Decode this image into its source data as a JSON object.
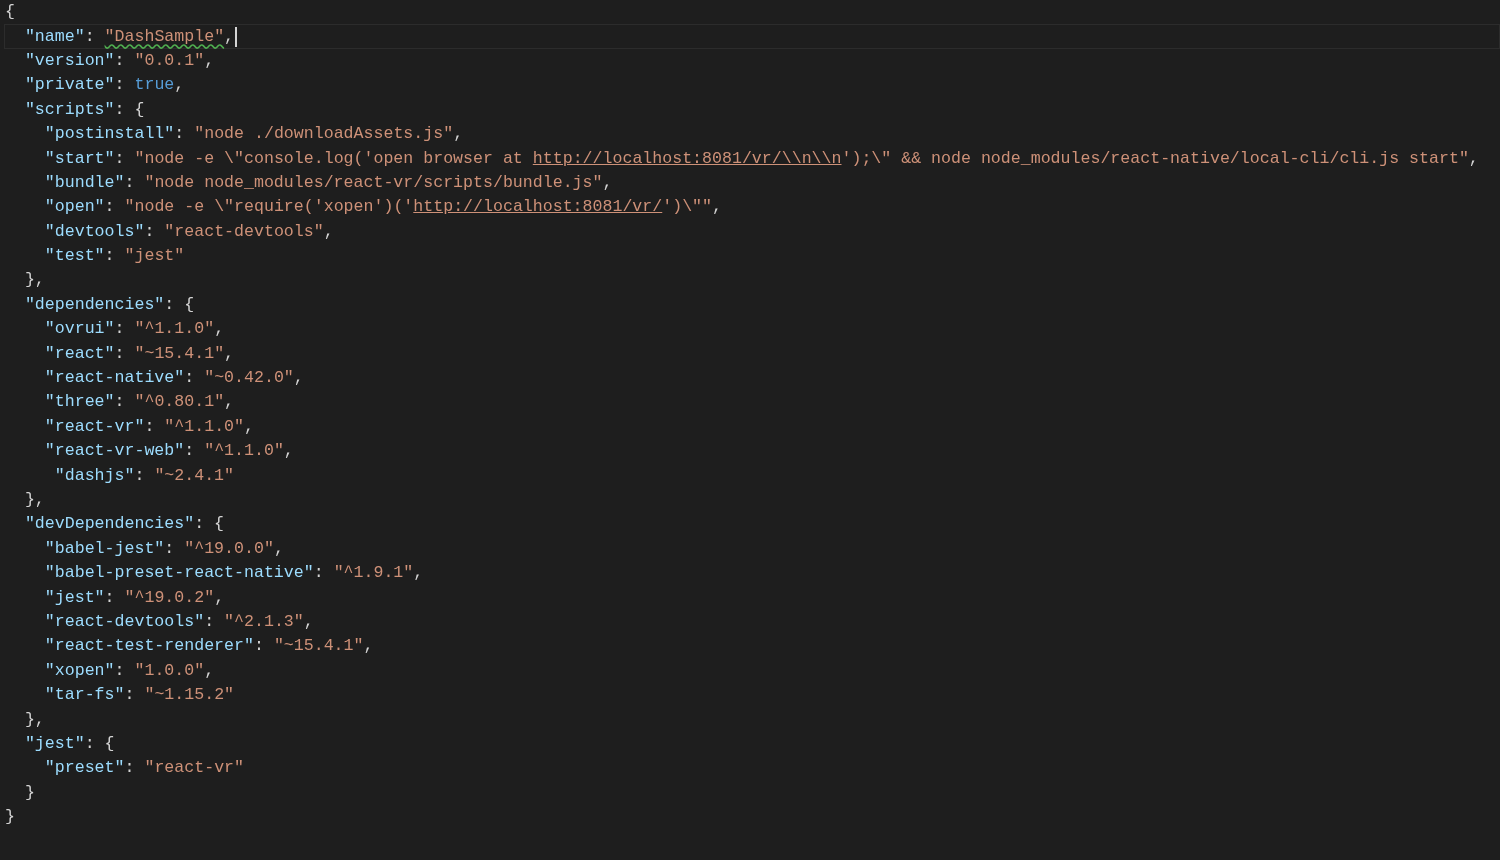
{
  "editor": {
    "lines": [
      {
        "current": false,
        "cursor": false,
        "tokens": [
          {
            "kind": "punct",
            "text": "{"
          }
        ]
      },
      {
        "current": true,
        "cursor": true,
        "tokens": [
          {
            "kind": "key",
            "text": "  \"name\""
          },
          {
            "kind": "punct",
            "text": ": "
          },
          {
            "kind": "string",
            "text": "\"DashSample\"",
            "squiggle": true
          },
          {
            "kind": "punct",
            "text": ","
          }
        ]
      },
      {
        "current": false,
        "cursor": false,
        "tokens": [
          {
            "kind": "key",
            "text": "  \"version\""
          },
          {
            "kind": "punct",
            "text": ": "
          },
          {
            "kind": "string",
            "text": "\"0.0.1\""
          },
          {
            "kind": "punct",
            "text": ","
          }
        ]
      },
      {
        "current": false,
        "cursor": false,
        "tokens": [
          {
            "kind": "key",
            "text": "  \"private\""
          },
          {
            "kind": "punct",
            "text": ": "
          },
          {
            "kind": "bool",
            "text": "true"
          },
          {
            "kind": "punct",
            "text": ","
          }
        ]
      },
      {
        "current": false,
        "cursor": false,
        "tokens": [
          {
            "kind": "key",
            "text": "  \"scripts\""
          },
          {
            "kind": "punct",
            "text": ": {"
          }
        ]
      },
      {
        "current": false,
        "cursor": false,
        "tokens": [
          {
            "kind": "key",
            "text": "    \"postinstall\""
          },
          {
            "kind": "punct",
            "text": ": "
          },
          {
            "kind": "string",
            "text": "\"node ./downloadAssets.js\""
          },
          {
            "kind": "punct",
            "text": ","
          }
        ]
      },
      {
        "current": false,
        "cursor": false,
        "tokens": [
          {
            "kind": "key",
            "text": "    \"start\""
          },
          {
            "kind": "punct",
            "text": ": "
          },
          {
            "kind": "string",
            "text": "\"node -e \\\"console.log('open browser at "
          },
          {
            "kind": "link",
            "text": "http://localhost:8081/vr/\\\\n\\\\n"
          },
          {
            "kind": "string",
            "text": "');\\\" && node node_modules/react-native/local-cli/cli.js start\""
          },
          {
            "kind": "punct",
            "text": ","
          }
        ]
      },
      {
        "current": false,
        "cursor": false,
        "tokens": [
          {
            "kind": "key",
            "text": "    \"bundle\""
          },
          {
            "kind": "punct",
            "text": ": "
          },
          {
            "kind": "string",
            "text": "\"node node_modules/react-vr/scripts/bundle.js\""
          },
          {
            "kind": "punct",
            "text": ","
          }
        ]
      },
      {
        "current": false,
        "cursor": false,
        "tokens": [
          {
            "kind": "key",
            "text": "    \"open\""
          },
          {
            "kind": "punct",
            "text": ": "
          },
          {
            "kind": "string",
            "text": "\"node -e \\\"require('xopen')('"
          },
          {
            "kind": "link",
            "text": "http://localhost:8081/vr/"
          },
          {
            "kind": "string",
            "text": "')\\\"\""
          },
          {
            "kind": "punct",
            "text": ","
          }
        ]
      },
      {
        "current": false,
        "cursor": false,
        "tokens": [
          {
            "kind": "key",
            "text": "    \"devtools\""
          },
          {
            "kind": "punct",
            "text": ": "
          },
          {
            "kind": "string",
            "text": "\"react-devtools\""
          },
          {
            "kind": "punct",
            "text": ","
          }
        ]
      },
      {
        "current": false,
        "cursor": false,
        "tokens": [
          {
            "kind": "key",
            "text": "    \"test\""
          },
          {
            "kind": "punct",
            "text": ": "
          },
          {
            "kind": "string",
            "text": "\"jest\""
          }
        ]
      },
      {
        "current": false,
        "cursor": false,
        "tokens": [
          {
            "kind": "punct",
            "text": "  },"
          }
        ]
      },
      {
        "current": false,
        "cursor": false,
        "tokens": [
          {
            "kind": "key",
            "text": "  \"dependencies\""
          },
          {
            "kind": "punct",
            "text": ": {"
          }
        ]
      },
      {
        "current": false,
        "cursor": false,
        "tokens": [
          {
            "kind": "key",
            "text": "    \"ovrui\""
          },
          {
            "kind": "punct",
            "text": ": "
          },
          {
            "kind": "string",
            "text": "\"^1.1.0\""
          },
          {
            "kind": "punct",
            "text": ","
          }
        ]
      },
      {
        "current": false,
        "cursor": false,
        "tokens": [
          {
            "kind": "key",
            "text": "    \"react\""
          },
          {
            "kind": "punct",
            "text": ": "
          },
          {
            "kind": "string",
            "text": "\"~15.4.1\""
          },
          {
            "kind": "punct",
            "text": ","
          }
        ]
      },
      {
        "current": false,
        "cursor": false,
        "tokens": [
          {
            "kind": "key",
            "text": "    \"react-native\""
          },
          {
            "kind": "punct",
            "text": ": "
          },
          {
            "kind": "string",
            "text": "\"~0.42.0\""
          },
          {
            "kind": "punct",
            "text": ","
          }
        ]
      },
      {
        "current": false,
        "cursor": false,
        "tokens": [
          {
            "kind": "key",
            "text": "    \"three\""
          },
          {
            "kind": "punct",
            "text": ": "
          },
          {
            "kind": "string",
            "text": "\"^0.80.1\""
          },
          {
            "kind": "punct",
            "text": ","
          }
        ]
      },
      {
        "current": false,
        "cursor": false,
        "tokens": [
          {
            "kind": "key",
            "text": "    \"react-vr\""
          },
          {
            "kind": "punct",
            "text": ": "
          },
          {
            "kind": "string",
            "text": "\"^1.1.0\""
          },
          {
            "kind": "punct",
            "text": ","
          }
        ]
      },
      {
        "current": false,
        "cursor": false,
        "tokens": [
          {
            "kind": "key",
            "text": "    \"react-vr-web\""
          },
          {
            "kind": "punct",
            "text": ": "
          },
          {
            "kind": "string",
            "text": "\"^1.1.0\""
          },
          {
            "kind": "punct",
            "text": ","
          }
        ]
      },
      {
        "current": false,
        "cursor": false,
        "tokens": [
          {
            "kind": "key",
            "text": "     \"dashjs\""
          },
          {
            "kind": "punct",
            "text": ": "
          },
          {
            "kind": "string",
            "text": "\"~2.4.1\""
          }
        ]
      },
      {
        "current": false,
        "cursor": false,
        "tokens": [
          {
            "kind": "punct",
            "text": "  },"
          }
        ]
      },
      {
        "current": false,
        "cursor": false,
        "tokens": [
          {
            "kind": "key",
            "text": "  \"devDependencies\""
          },
          {
            "kind": "punct",
            "text": ": {"
          }
        ]
      },
      {
        "current": false,
        "cursor": false,
        "tokens": [
          {
            "kind": "key",
            "text": "    \"babel-jest\""
          },
          {
            "kind": "punct",
            "text": ": "
          },
          {
            "kind": "string",
            "text": "\"^19.0.0\""
          },
          {
            "kind": "punct",
            "text": ","
          }
        ]
      },
      {
        "current": false,
        "cursor": false,
        "tokens": [
          {
            "kind": "key",
            "text": "    \"babel-preset-react-native\""
          },
          {
            "kind": "punct",
            "text": ": "
          },
          {
            "kind": "string",
            "text": "\"^1.9.1\""
          },
          {
            "kind": "punct",
            "text": ","
          }
        ]
      },
      {
        "current": false,
        "cursor": false,
        "tokens": [
          {
            "kind": "key",
            "text": "    \"jest\""
          },
          {
            "kind": "punct",
            "text": ": "
          },
          {
            "kind": "string",
            "text": "\"^19.0.2\""
          },
          {
            "kind": "punct",
            "text": ","
          }
        ]
      },
      {
        "current": false,
        "cursor": false,
        "tokens": [
          {
            "kind": "key",
            "text": "    \"react-devtools\""
          },
          {
            "kind": "punct",
            "text": ": "
          },
          {
            "kind": "string",
            "text": "\"^2.1.3\""
          },
          {
            "kind": "punct",
            "text": ","
          }
        ]
      },
      {
        "current": false,
        "cursor": false,
        "tokens": [
          {
            "kind": "key",
            "text": "    \"react-test-renderer\""
          },
          {
            "kind": "punct",
            "text": ": "
          },
          {
            "kind": "string",
            "text": "\"~15.4.1\""
          },
          {
            "kind": "punct",
            "text": ","
          }
        ]
      },
      {
        "current": false,
        "cursor": false,
        "tokens": [
          {
            "kind": "key",
            "text": "    \"xopen\""
          },
          {
            "kind": "punct",
            "text": ": "
          },
          {
            "kind": "string",
            "text": "\"1.0.0\""
          },
          {
            "kind": "punct",
            "text": ","
          }
        ]
      },
      {
        "current": false,
        "cursor": false,
        "tokens": [
          {
            "kind": "key",
            "text": "    \"tar-fs\""
          },
          {
            "kind": "punct",
            "text": ": "
          },
          {
            "kind": "string",
            "text": "\"~1.15.2\""
          }
        ]
      },
      {
        "current": false,
        "cursor": false,
        "tokens": [
          {
            "kind": "punct",
            "text": "  },"
          }
        ]
      },
      {
        "current": false,
        "cursor": false,
        "tokens": [
          {
            "kind": "key",
            "text": "  \"jest\""
          },
          {
            "kind": "punct",
            "text": ": {"
          }
        ]
      },
      {
        "current": false,
        "cursor": false,
        "tokens": [
          {
            "kind": "key",
            "text": "    \"preset\""
          },
          {
            "kind": "punct",
            "text": ": "
          },
          {
            "kind": "string",
            "text": "\"react-vr\""
          }
        ]
      },
      {
        "current": false,
        "cursor": false,
        "tokens": [
          {
            "kind": "punct",
            "text": "  }"
          }
        ]
      },
      {
        "current": false,
        "cursor": false,
        "tokens": [
          {
            "kind": "punct",
            "text": "}"
          }
        ]
      }
    ]
  }
}
